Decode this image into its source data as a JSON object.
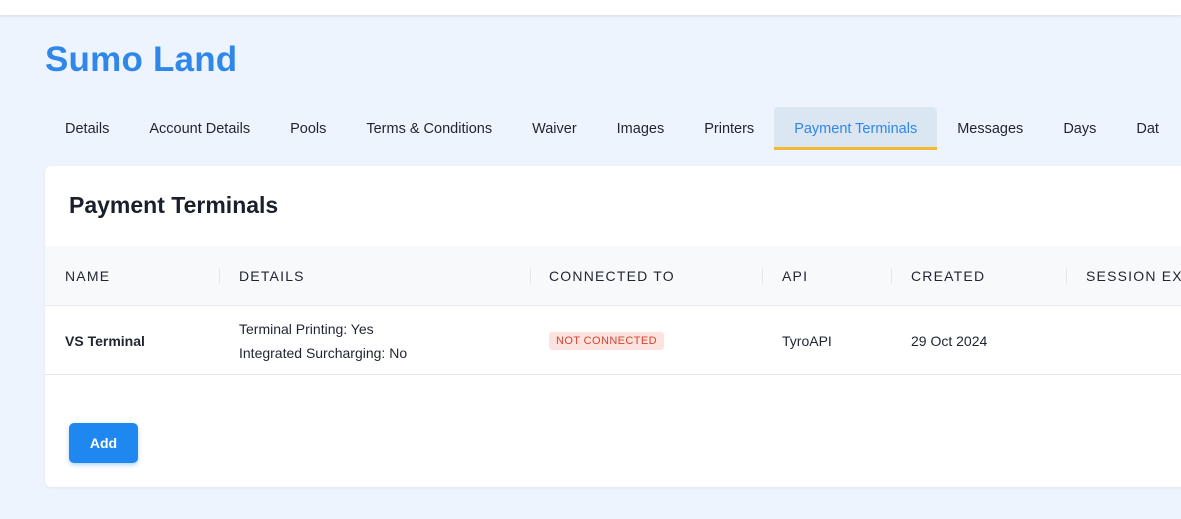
{
  "venue": {
    "title": "Sumo Land"
  },
  "tabs": [
    {
      "label": "Details",
      "active": false
    },
    {
      "label": "Account Details",
      "active": false
    },
    {
      "label": "Pools",
      "active": false
    },
    {
      "label": "Terms & Conditions",
      "active": false
    },
    {
      "label": "Waiver",
      "active": false
    },
    {
      "label": "Images",
      "active": false
    },
    {
      "label": "Printers",
      "active": false
    },
    {
      "label": "Payment Terminals",
      "active": true
    },
    {
      "label": "Messages",
      "active": false
    },
    {
      "label": "Days",
      "active": false
    },
    {
      "label": "Dat",
      "active": false
    }
  ],
  "card": {
    "title": "Payment Terminals"
  },
  "table": {
    "headers": [
      "NAME",
      "DETAILS",
      "CONNECTED TO",
      "API",
      "CREATED",
      "SESSION EXI"
    ],
    "rows": [
      {
        "name": "VS Terminal",
        "details": [
          "Terminal Printing: Yes",
          "Integrated Surcharging: No"
        ],
        "connected_to": "NOT CONNECTED",
        "api": "TyroAPI",
        "created": "29 Oct 2024",
        "session_expiry": ""
      }
    ]
  },
  "actions": {
    "add_label": "Add"
  },
  "colors": {
    "accent": "#2f87ea",
    "button": "#1e88f0",
    "active_tab_underline": "#f5b833",
    "badge_bg": "#fde3df",
    "badge_text": "#d3452f"
  }
}
